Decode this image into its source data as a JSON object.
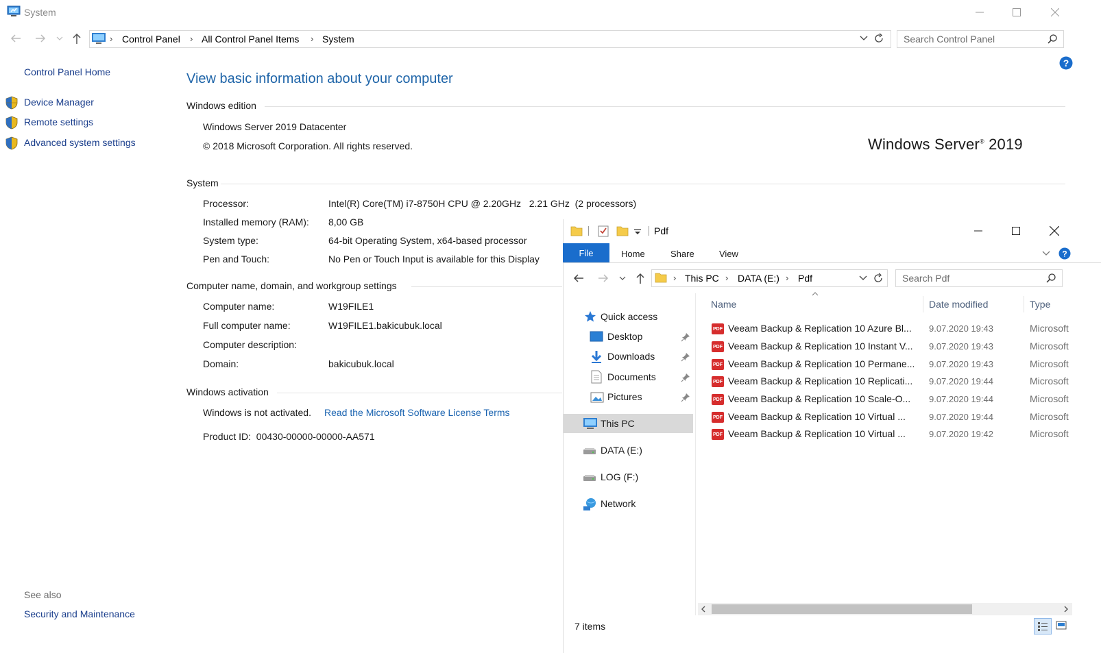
{
  "system_window": {
    "title": "System",
    "breadcrumbs": [
      "Control Panel",
      "All Control Panel Items",
      "System"
    ],
    "search_placeholder": "Search Control Panel",
    "left_nav": {
      "home": "Control Panel Home",
      "items": [
        "Device Manager",
        "Remote settings",
        "Advanced system settings"
      ],
      "see_also_title": "See also",
      "see_also_items": [
        "Security and Maintenance"
      ]
    },
    "heading": "View basic information about your computer",
    "windows_edition": {
      "title": "Windows edition",
      "edition": "Windows Server 2019 Datacenter",
      "copyright": "© 2018 Microsoft Corporation. All rights reserved.",
      "brand_name": "Windows Server",
      "brand_sup": "®",
      "brand_year": "2019"
    },
    "system": {
      "title": "System",
      "rows": [
        {
          "label": "Processor:",
          "value": "Intel(R) Core(TM) i7-8750H CPU @ 2.20GHz   2.21 GHz  (2 processors)"
        },
        {
          "label": "Installed memory (RAM):",
          "value": "8,00 GB"
        },
        {
          "label": "System type:",
          "value": "64-bit Operating System, x64-based processor"
        },
        {
          "label": "Pen and Touch:",
          "value": "No Pen or Touch Input is available for this Display"
        }
      ]
    },
    "computer_name": {
      "title": "Computer name, domain, and workgroup settings",
      "rows": [
        {
          "label": "Computer name:",
          "value": "W19FILE1"
        },
        {
          "label": "Full computer name:",
          "value": "W19FILE1.bakicubuk.local"
        },
        {
          "label": "Computer description:",
          "value": ""
        },
        {
          "label": "Domain:",
          "value": "bakicubuk.local"
        }
      ]
    },
    "activation": {
      "title": "Windows activation",
      "status": "Windows is not activated.",
      "license_link": "Read the Microsoft Software License Terms",
      "product_id": "Product ID:  00430-00000-00000-AA571"
    }
  },
  "explorer_window": {
    "title": "Pdf",
    "ribbon_tabs": [
      "File",
      "Home",
      "Share",
      "View"
    ],
    "breadcrumbs": [
      "This PC",
      "DATA (E:)",
      "Pdf"
    ],
    "search_placeholder": "Search Pdf",
    "nav_pane": {
      "quick_access": "Quick access",
      "pinned": [
        "Desktop",
        "Downloads",
        "Documents",
        "Pictures"
      ],
      "this_pc": "This PC",
      "drives": [
        "DATA (E:)",
        "LOG (F:)"
      ],
      "network": "Network"
    },
    "columns": [
      "Name",
      "Date modified",
      "Type"
    ],
    "files": [
      {
        "name": "Veeam Backup & Replication 10 Azure Bl...",
        "date": "9.07.2020 19:43",
        "type": "Microsoft"
      },
      {
        "name": "Veeam Backup & Replication 10 Instant V...",
        "date": "9.07.2020 19:43",
        "type": "Microsoft"
      },
      {
        "name": "Veeam Backup & Replication 10 Permane...",
        "date": "9.07.2020 19:43",
        "type": "Microsoft"
      },
      {
        "name": "Veeam Backup & Replication 10 Replicati...",
        "date": "9.07.2020 19:44",
        "type": "Microsoft"
      },
      {
        "name": "Veeam Backup & Replication 10 Scale-O...",
        "date": "9.07.2020 19:44",
        "type": "Microsoft"
      },
      {
        "name": "Veeam Backup & Replication 10 Virtual ...",
        "date": "9.07.2020 19:44",
        "type": "Microsoft"
      },
      {
        "name": "Veeam Backup & Replication 10 Virtual ...",
        "date": "9.07.2020 19:42",
        "type": "Microsoft"
      }
    ],
    "pdf_icon_text": "PDF",
    "status": "7 items"
  },
  "colors": {
    "accent_blue": "#1a6dcc",
    "link_blue": "#1a63b0",
    "heading_blue": "#1e64a8",
    "shield_gold": "#e8b820",
    "pdf_red": "#d62d2d"
  }
}
